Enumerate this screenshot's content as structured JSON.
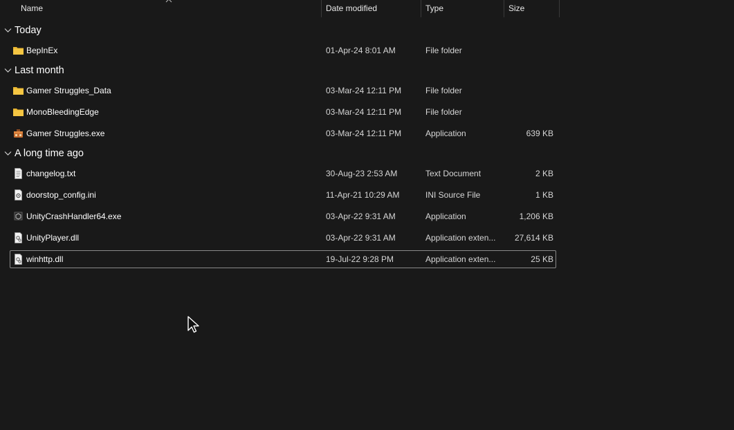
{
  "columns": {
    "name": "Name",
    "date_modified": "Date modified",
    "type": "Type",
    "size": "Size"
  },
  "groups": [
    {
      "label": "Today",
      "items": [
        {
          "name": "BepInEx",
          "date": "01-Apr-24 8:01 AM",
          "type": "File folder",
          "size": "",
          "icon": "folder-icon"
        }
      ]
    },
    {
      "label": "Last month",
      "items": [
        {
          "name": "Gamer Struggles_Data",
          "date": "03-Mar-24 12:11 PM",
          "type": "File folder",
          "size": "",
          "icon": "folder-icon"
        },
        {
          "name": "MonoBleedingEdge",
          "date": "03-Mar-24 12:11 PM",
          "type": "File folder",
          "size": "",
          "icon": "folder-icon"
        },
        {
          "name": "Gamer Struggles.exe",
          "date": "03-Mar-24 12:11 PM",
          "type": "Application",
          "size": "639 KB",
          "icon": "app-exe-icon"
        }
      ]
    },
    {
      "label": "A long time ago",
      "items": [
        {
          "name": "changelog.txt",
          "date": "30-Aug-23 2:53 AM",
          "type": "Text Document",
          "size": "2 KB",
          "icon": "text-document-icon"
        },
        {
          "name": "doorstop_config.ini",
          "date": "11-Apr-21 10:29 AM",
          "type": "INI Source File",
          "size": "1 KB",
          "icon": "ini-file-icon"
        },
        {
          "name": "UnityCrashHandler64.exe",
          "date": "03-Apr-22 9:31 AM",
          "type": "Application",
          "size": "1,206 KB",
          "icon": "unity-exe-icon"
        },
        {
          "name": "UnityPlayer.dll",
          "date": "03-Apr-22 9:31 AM",
          "type": "Application exten...",
          "size": "27,614 KB",
          "icon": "dll-file-icon"
        },
        {
          "name": "winhttp.dll",
          "date": "19-Jul-22 9:28 PM",
          "type": "Application exten...",
          "size": "25 KB",
          "icon": "dll-file-icon"
        }
      ]
    }
  ],
  "colors": {
    "background": "#191919",
    "folder": "#f4c542",
    "focus_border": "#8a8a8a"
  }
}
